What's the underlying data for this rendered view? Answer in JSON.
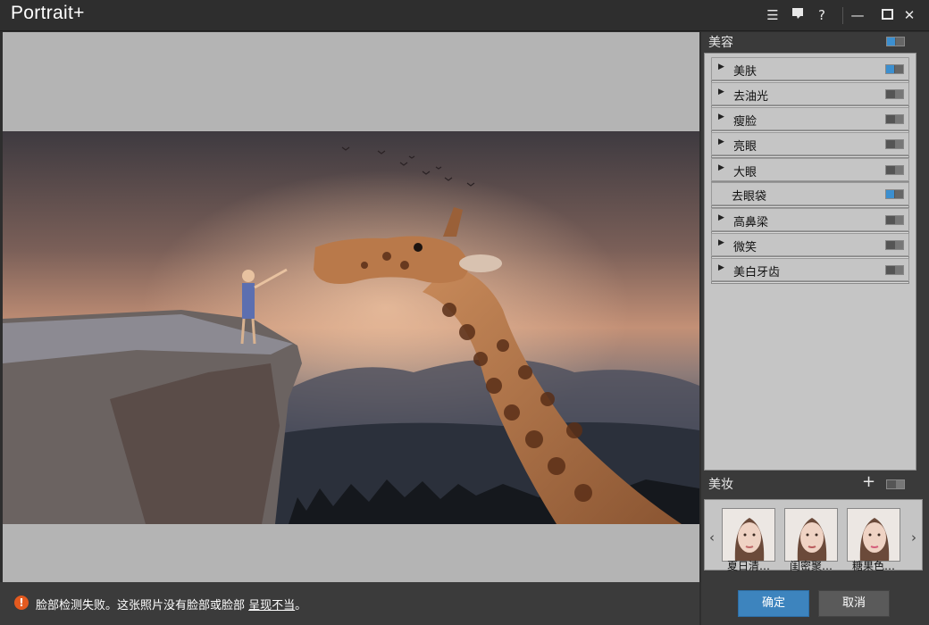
{
  "app": {
    "title": "Portrait+"
  },
  "titlebar_icons": [
    "list-icon",
    "comment-icon",
    "help-icon",
    "minimize-icon",
    "maximize-icon",
    "close-icon"
  ],
  "titlebar_glyphs": {
    "list": "☰",
    "comment": "▬",
    "help": "?",
    "minimize": "—",
    "maximize": "▢",
    "close": "✕"
  },
  "beauty": {
    "title": "美容",
    "enabled": true,
    "items": [
      {
        "label": "美肤",
        "expandable": true,
        "on": true
      },
      {
        "label": "去油光",
        "expandable": true,
        "on": false
      },
      {
        "label": "瘦脸",
        "expandable": true,
        "on": false
      },
      {
        "label": "亮眼",
        "expandable": true,
        "on": false
      },
      {
        "label": "大眼",
        "expandable": true,
        "on": false
      },
      {
        "label": "去眼袋",
        "expandable": false,
        "on": true
      },
      {
        "label": "高鼻梁",
        "expandable": true,
        "on": false
      },
      {
        "label": "微笑",
        "expandable": true,
        "on": false
      },
      {
        "label": "美白牙齿",
        "expandable": true,
        "on": false
      }
    ]
  },
  "makeup": {
    "title": "美妆",
    "enabled": false,
    "add_glyph": "+",
    "prev_glyph": "‹",
    "next_glyph": "›",
    "presets": [
      {
        "label": "夏日清…"
      },
      {
        "label": "闺密聚…"
      },
      {
        "label": "糖果色…"
      }
    ]
  },
  "status": {
    "icon": "warning-icon",
    "icon_glyph": "!",
    "message": "脸部检测失败。这张照片没有脸部或脸部",
    "link": "呈现不当",
    "suffix": "。"
  },
  "buttons": {
    "ok": "确定",
    "cancel": "取消"
  },
  "colors": {
    "accent": "#3d84be",
    "warning": "#e45a1f",
    "toggle_on": "#3c8fcf"
  }
}
